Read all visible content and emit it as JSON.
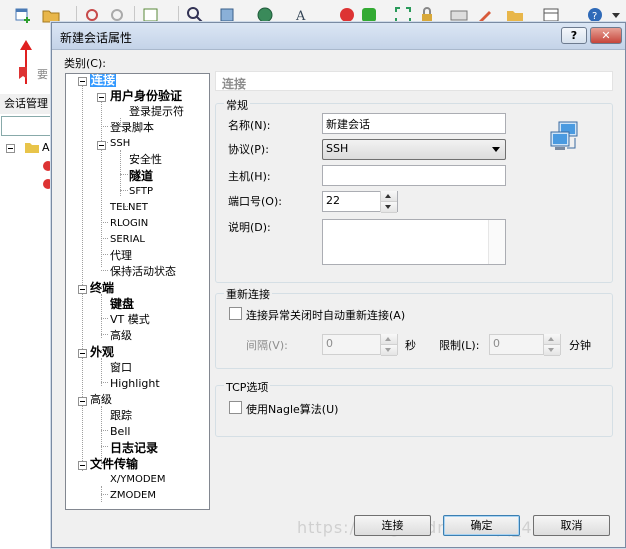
{
  "app": {
    "panel_header": "会话管理",
    "tree_letter": "A",
    "side_label": "要"
  },
  "dialog": {
    "title": "新建会话属性",
    "help_button": "?",
    "close_button": "✕",
    "category_label": "类别(C):",
    "tree": [
      {
        "label": "连接",
        "bold": true,
        "selected": true
      },
      {
        "label": "用户身份验证",
        "bold": true
      },
      {
        "label": "登录提示符"
      },
      {
        "label": "登录脚本"
      },
      {
        "label": "SSH"
      },
      {
        "label": "安全性"
      },
      {
        "label": "隧道",
        "bold": true
      },
      {
        "label": "SFTP"
      },
      {
        "label": "TELNET"
      },
      {
        "label": "RLOGIN"
      },
      {
        "label": "SERIAL"
      },
      {
        "label": "代理"
      },
      {
        "label": "保持活动状态"
      },
      {
        "label": "终端",
        "bold": true
      },
      {
        "label": "键盘",
        "bold": true
      },
      {
        "label": "VT 模式"
      },
      {
        "label": "高级"
      },
      {
        "label": "外观",
        "bold": true
      },
      {
        "label": "窗口"
      },
      {
        "label": "Highlight"
      },
      {
        "label": "高级"
      },
      {
        "label": "跟踪"
      },
      {
        "label": "Bell"
      },
      {
        "label": "日志记录",
        "bold": true
      },
      {
        "label": "文件传输",
        "bold": true
      },
      {
        "label": "X/YMODEM"
      },
      {
        "label": "ZMODEM"
      }
    ],
    "section_title": "连接",
    "general": {
      "title": "常规",
      "name_label": "名称(N):",
      "name_value": "新建会话",
      "protocol_label": "协议(P):",
      "protocol_value": "SSH",
      "host_label": "主机(H):",
      "host_value": "",
      "port_label": "端口号(O):",
      "port_value": "22",
      "desc_label": "说明(D):",
      "desc_value": ""
    },
    "reconnect": {
      "title": "重新连接",
      "checkbox_label": "连接异常关闭时自动重新连接(A)",
      "interval_label": "间隔(V):",
      "interval_value": "0",
      "seconds_label": "秒",
      "limit_label": "限制(L):",
      "limit_value": "0",
      "minutes_label": "分钟"
    },
    "tcp": {
      "title": "TCP选项",
      "nagle_label": "使用Nagle算法(U)"
    },
    "buttons": {
      "connect": "连接",
      "ok": "确定",
      "cancel": "取消"
    },
    "watermark": "https://blog.csdn.net/qq_42180306"
  }
}
